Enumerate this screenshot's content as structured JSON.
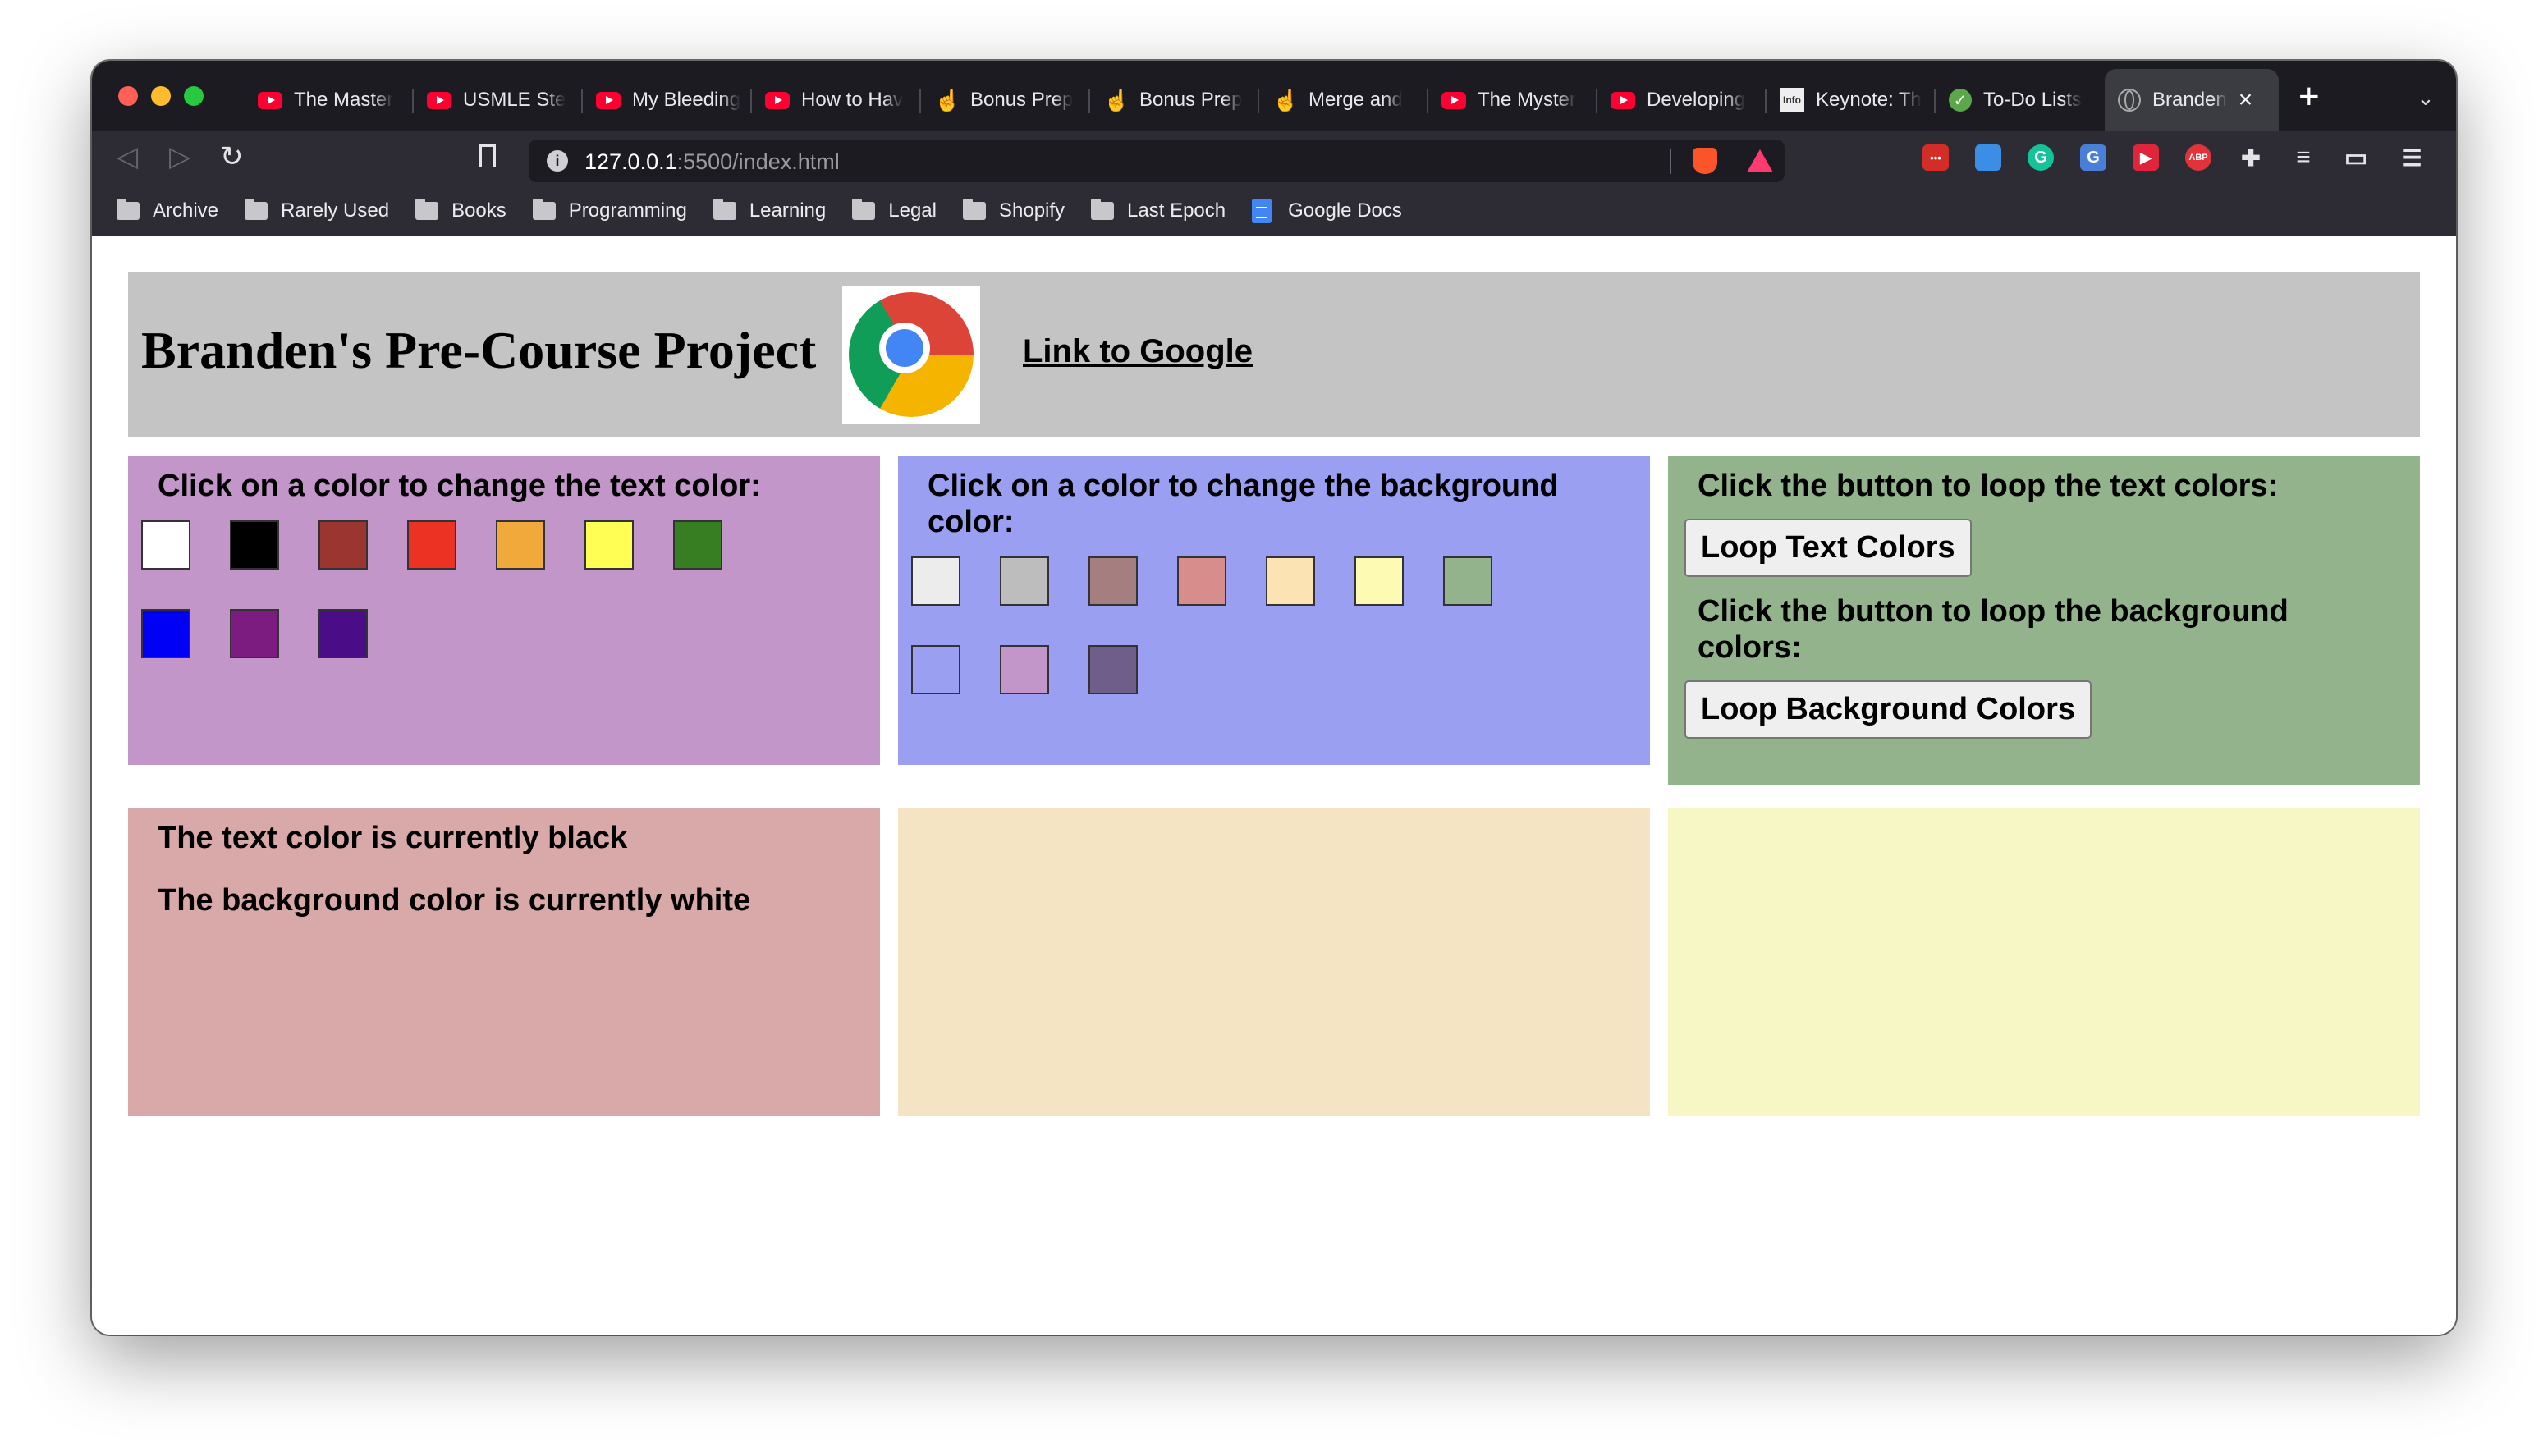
{
  "browser": {
    "tabs": [
      {
        "title": "The Master",
        "favicon": "youtube-icon"
      },
      {
        "title": "USMLE Ste",
        "favicon": "youtube-icon"
      },
      {
        "title": "My Bleeding",
        "favicon": "youtube-icon"
      },
      {
        "title": "How to Hav",
        "favicon": "youtube-icon"
      },
      {
        "title": "Bonus Prep",
        "favicon": "hand-icon"
      },
      {
        "title": "Bonus Prep",
        "favicon": "hand-icon"
      },
      {
        "title": "Merge and",
        "favicon": "hand-icon"
      },
      {
        "title": "The Myster",
        "favicon": "youtube-icon"
      },
      {
        "title": "Developing",
        "favicon": "youtube-icon"
      },
      {
        "title": "Keynote: Th",
        "favicon": "info-icon"
      },
      {
        "title": "To-Do Lists",
        "favicon": "check-icon"
      },
      {
        "title": "Branden",
        "favicon": "globe-icon",
        "active": true
      }
    ],
    "new_tab": "+",
    "url_host": "127.0.0.1",
    "url_path": ":5500/index.html",
    "bookmarks": [
      {
        "label": "Archive",
        "icon": "folder-icon"
      },
      {
        "label": "Rarely Used",
        "icon": "folder-icon"
      },
      {
        "label": "Books",
        "icon": "folder-icon"
      },
      {
        "label": "Programming",
        "icon": "folder-icon"
      },
      {
        "label": "Learning",
        "icon": "folder-icon"
      },
      {
        "label": "Legal",
        "icon": "folder-icon"
      },
      {
        "label": "Shopify",
        "icon": "folder-icon"
      },
      {
        "label": "Last Epoch",
        "icon": "folder-icon"
      },
      {
        "label": "Google Docs",
        "icon": "google-docs-icon"
      }
    ],
    "extensions": [
      {
        "name": "lastpass-icon",
        "label": "•••",
        "color": "#d32d27"
      },
      {
        "name": "photo-icon",
        "label": "",
        "color": "#3a8ee6"
      },
      {
        "name": "grammarly-icon",
        "label": "G",
        "color": "#15c39a"
      },
      {
        "name": "translate-icon",
        "label": "G",
        "color": "#4a7fd8"
      },
      {
        "name": "video-icon",
        "label": "▶",
        "color": "#e0243a"
      },
      {
        "name": "adblock-icon",
        "label": "ABP",
        "color": "#e0343a"
      },
      {
        "name": "puzzle-icon",
        "label": "✚",
        "color": "#2d2c34"
      },
      {
        "name": "playlist-icon",
        "label": "≡",
        "color": "#2d2c34"
      },
      {
        "name": "wallet-icon",
        "label": "▭",
        "color": "#2d2c34"
      },
      {
        "name": "menu-icon",
        "label": "☰",
        "color": "#2d2c34"
      }
    ]
  },
  "page": {
    "title": "Branden's Pre-Course Project",
    "link_text": "Link to Google",
    "text_panel": {
      "heading": "Click on a color to change the text color:",
      "colors": [
        "#ffffff",
        "#000000",
        "#9b3530",
        "#ec3323",
        "#f2a93b",
        "#fffe54",
        "#377e22",
        "#0000f5",
        "#7c1c80",
        "#4a0d87"
      ]
    },
    "bg_panel": {
      "heading": "Click on a color to change the background color:",
      "colors": [
        "#ececec",
        "#bdbdbd",
        "#a57f7f",
        "#d88d8d",
        "#fbe3b3",
        "#fdfbb3",
        "#93b38d",
        "#9b9ff2",
        "#c296c8",
        "#6f5d8a"
      ]
    },
    "loop_panel": {
      "text_heading": "Click the button to loop the text colors:",
      "text_button": "Loop Text Colors",
      "bg_heading": "Click the button to loop the background colors:",
      "bg_button": "Loop Background Colors"
    },
    "status": {
      "text_color_line": "The text color is currently black",
      "bg_color_line": "The background color is currently white"
    },
    "panel_colors": {
      "text": "#c296c8",
      "background": "#9b9ff2",
      "loop": "#93b38d",
      "status": "#d9a9a9",
      "empty_1": "#f4e4c4",
      "empty_2": "#f7f7c6",
      "header": "#c4c4c4"
    }
  }
}
